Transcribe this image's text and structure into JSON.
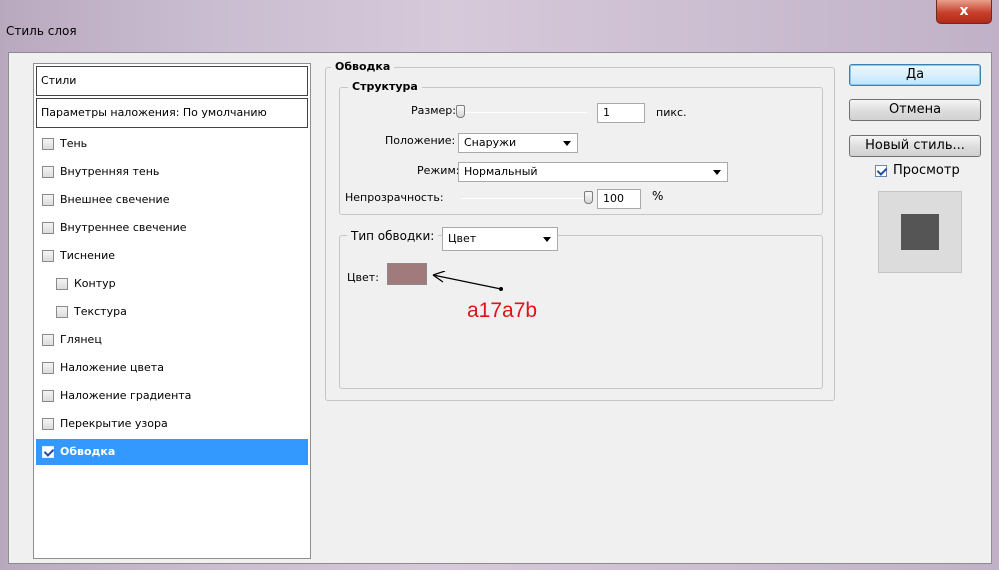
{
  "window": {
    "title": "Стиль слоя",
    "close_glyph": "x"
  },
  "sidebar": {
    "header": "Стили",
    "defaults": "Параметры наложения: По умолчанию",
    "items": [
      {
        "label": "Тень",
        "checked": false
      },
      {
        "label": "Внутренняя тень",
        "checked": false
      },
      {
        "label": "Внешнее свечение",
        "checked": false
      },
      {
        "label": "Внутреннее свечение",
        "checked": false
      },
      {
        "label": "Тиснение",
        "checked": false
      },
      {
        "label": "Контур",
        "checked": false
      },
      {
        "label": "Текстура",
        "checked": false
      },
      {
        "label": "Глянец",
        "checked": false
      },
      {
        "label": "Наложение цвета",
        "checked": false
      },
      {
        "label": "Наложение градиента",
        "checked": false
      },
      {
        "label": "Перекрытие узора",
        "checked": false
      },
      {
        "label": "Обводка",
        "checked": true
      }
    ]
  },
  "stroke": {
    "section_title": "Обводка",
    "structure_title": "Структура",
    "size_label": "Размер:",
    "size_value": "1",
    "size_unit": "пикс.",
    "position_label": "Положение:",
    "position_value": "Снаружи",
    "mode_label": "Режим:",
    "mode_value": "Нормальный",
    "opacity_label": "Непрозрачность:",
    "opacity_value": "100",
    "opacity_unit": "%",
    "fill_type_label": "Тип обводки:",
    "fill_type_value": "Цвет",
    "color_label": "Цвет:",
    "color_swatch": "#a17a7b"
  },
  "annotation": {
    "text": "a17a7b",
    "color": "#e0121a"
  },
  "buttons": {
    "ok": "Да",
    "cancel": "Отмена",
    "new_style": "Новый стиль...",
    "preview_label": "Просмотр",
    "preview_checked": true
  },
  "colors": {
    "selection": "#3399ff",
    "preview_swatch": "#555555"
  }
}
